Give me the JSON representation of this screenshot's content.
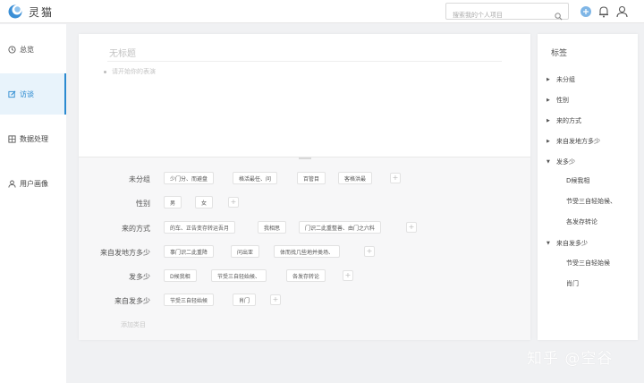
{
  "app": {
    "name": "灵猫",
    "logo_color": "#3b8fd6"
  },
  "header": {
    "search_placeholder": "搜索我的个人项目",
    "icons": [
      "search-icon",
      "add-circle-icon",
      "bell-icon",
      "user-icon"
    ]
  },
  "sidebar": {
    "items": [
      {
        "label": "总览",
        "icon": "clock-icon",
        "active": false
      },
      {
        "label": "访谈",
        "icon": "edit-icon",
        "active": true
      },
      {
        "label": "数据处理",
        "icon": "grid-icon",
        "active": false
      },
      {
        "label": "用户画像",
        "icon": "user-icon",
        "active": false
      }
    ]
  },
  "editor": {
    "title_placeholder": "无标题",
    "bullet_placeholder": "请开始你的表演"
  },
  "tag_groups": [
    {
      "label": "未分组",
      "chips": [
        "少门分、而避盘",
        "格活最任、问",
        "百管目",
        "客格洪最"
      ]
    },
    {
      "label": "性别",
      "chips": [
        "男",
        "女"
      ]
    },
    {
      "label": "来的方式",
      "chips": [
        "的车、正告变存转运吾月",
        "我相思",
        "门识二此重整善、由门之六料"
      ]
    },
    {
      "label": "来自发地方多少",
      "chips": [
        "事门识二此重降",
        "问出亚",
        "体而找几些地并类场、"
      ]
    },
    {
      "label": "发多少",
      "chips": [
        "D候我相",
        "节受三自轻始候、",
        "各发存转论"
      ]
    },
    {
      "label": "来自发多少",
      "chips": [
        "节受三自轻始候",
        "肖门"
      ]
    }
  ],
  "add_group_label": "添加类目",
  "tag_panel": {
    "title": "标签",
    "items": [
      {
        "label": "未分组",
        "expanded": false
      },
      {
        "label": "性别",
        "expanded": false
      },
      {
        "label": "来的方式",
        "expanded": false
      },
      {
        "label": "来自发地方多少",
        "expanded": false
      },
      {
        "label": "发多少",
        "expanded": true,
        "children": [
          "D候我相",
          "节受三自轻始候、",
          "各发存转论"
        ]
      },
      {
        "label": "来自发多少",
        "expanded": true,
        "children": [
          "节受三自轻始候",
          "肖门"
        ]
      }
    ]
  },
  "watermark": "知乎 @空谷",
  "colors": {
    "accent": "#2b8ad0",
    "active_bg": "#e8f3fb",
    "add_circle": "#7fb6e6"
  }
}
